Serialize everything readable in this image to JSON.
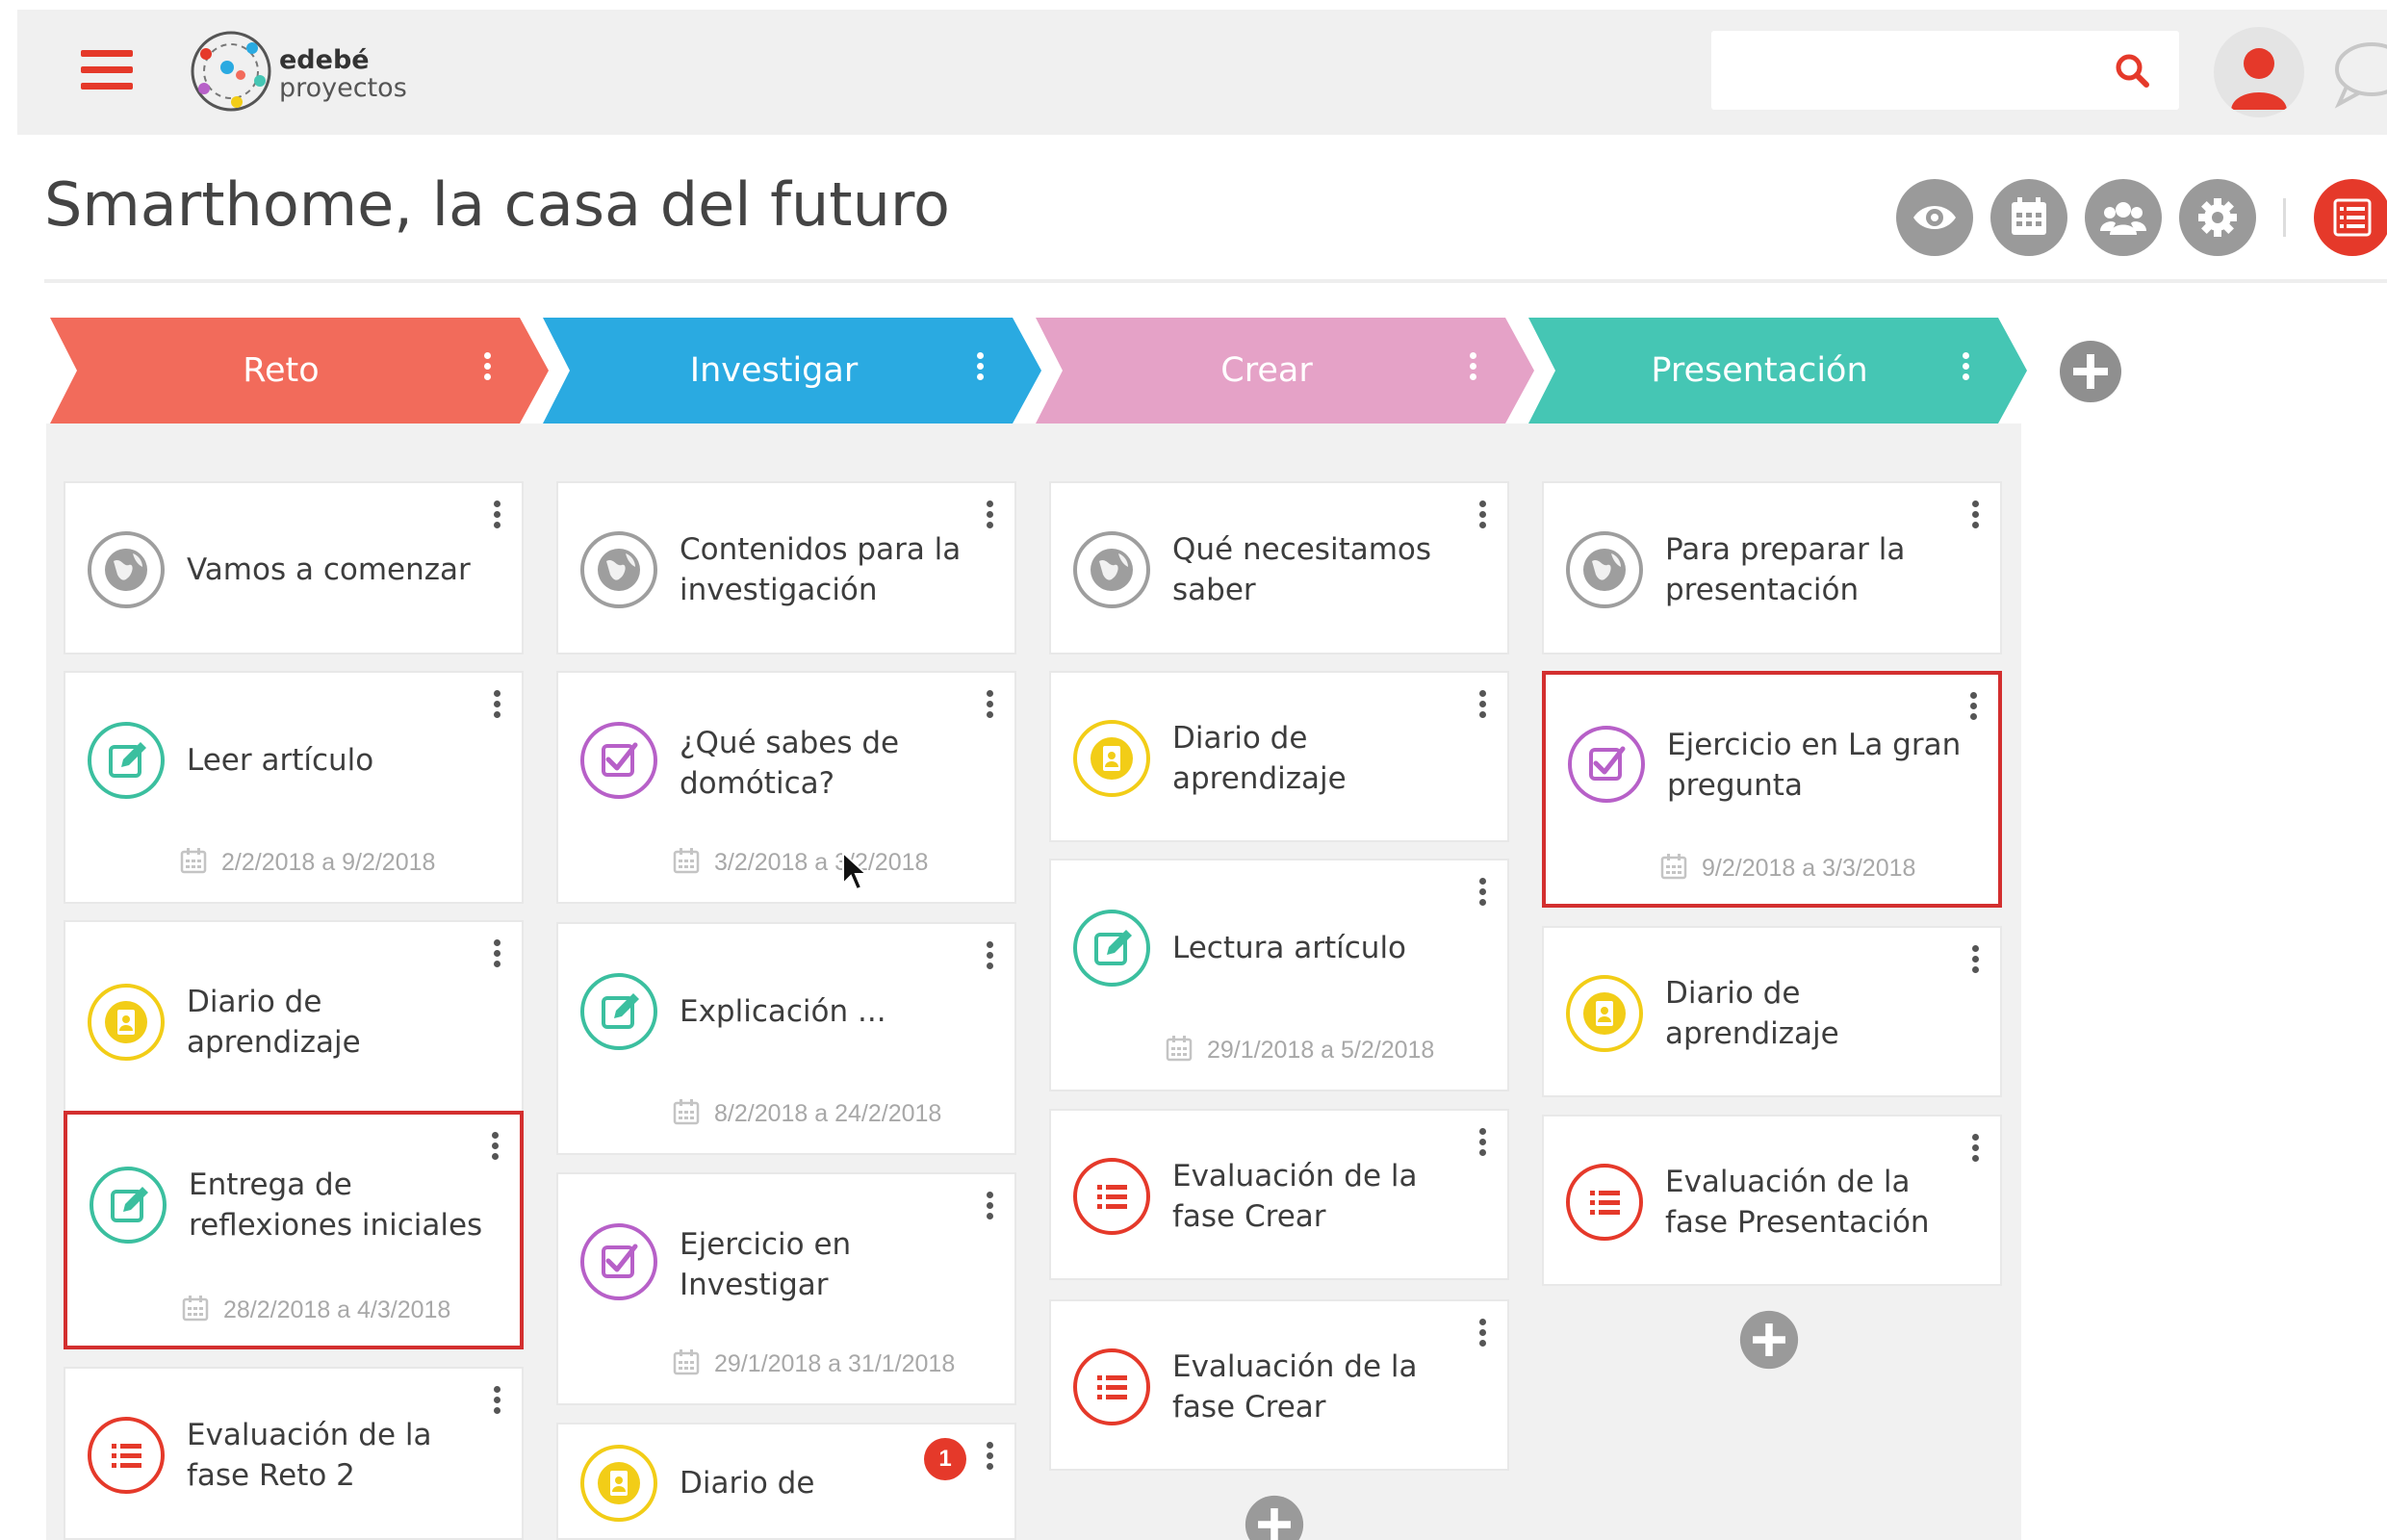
{
  "header": {
    "logo_line1": "edebé",
    "logo_line2": "proyectos",
    "search_placeholder": "",
    "search_value": ""
  },
  "page": {
    "title": "Smarthome, la casa del futuro"
  },
  "toolbar": {
    "icons": [
      "eye-icon",
      "calendar-icon",
      "group-icon",
      "gear-icon",
      "list-icon"
    ]
  },
  "colors": {
    "accent": "#e5392a",
    "reto": "#f26b5b",
    "investigar": "#2aaae1",
    "crear": "#e5a2c7",
    "presentacion": "#45c6b4",
    "icon_globe": "#9e9e9e",
    "icon_edit": "#3bbf9f",
    "icon_check": "#b760c8",
    "icon_diary": "#f2cd17",
    "icon_list": "#e5392a"
  },
  "columns": [
    {
      "title": "Reto",
      "cards": [
        {
          "type": "globe",
          "title": "Vamos a comenzar"
        },
        {
          "type": "edit",
          "title": "Leer artículo",
          "date": "2/2/2018 a 9/2/2018"
        },
        {
          "type": "diary",
          "title": "Diario de aprendizaje"
        },
        {
          "type": "edit",
          "title": "Entrega de reflexiones iniciales",
          "date": "28/2/2018 a 4/3/2018"
        },
        {
          "type": "list",
          "title": "Evaluación de la fase Reto 2"
        }
      ]
    },
    {
      "title": "Investigar",
      "cards": [
        {
          "type": "globe",
          "title": "Contenidos para la investigación"
        },
        {
          "type": "check",
          "title": "¿Qué sabes de domótica?",
          "date": "3/2/2018 a 3/2/2018"
        },
        {
          "type": "edit",
          "title": "Explicación ...",
          "date": "8/2/2018 a 24/2/2018"
        },
        {
          "type": "check",
          "title": "Ejercicio en Investigar",
          "date": "29/1/2018 a 31/1/2018"
        },
        {
          "type": "diary",
          "title": "Diario de",
          "badge": "1"
        }
      ]
    },
    {
      "title": "Crear",
      "cards": [
        {
          "type": "globe",
          "title": "Qué necesitamos saber"
        },
        {
          "type": "diary",
          "title": "Diario de aprendizaje"
        },
        {
          "type": "edit",
          "title": "Lectura artículo",
          "date": "29/1/2018 a 5/2/2018"
        },
        {
          "type": "list",
          "title": "Evaluación de la fase Crear"
        },
        {
          "type": "list",
          "title": "Evaluación de la fase Crear"
        }
      ]
    },
    {
      "title": "Presentación",
      "cards": [
        {
          "type": "globe",
          "title": "Para preparar la presentación"
        },
        {
          "type": "check",
          "title": "Ejercicio en La gran pregunta",
          "date": "9/2/2018 a 3/3/2018"
        },
        {
          "type": "diary",
          "title": "Diario de aprendizaje"
        },
        {
          "type": "list",
          "title": "Evaluación de la fase Presentación"
        }
      ]
    }
  ]
}
